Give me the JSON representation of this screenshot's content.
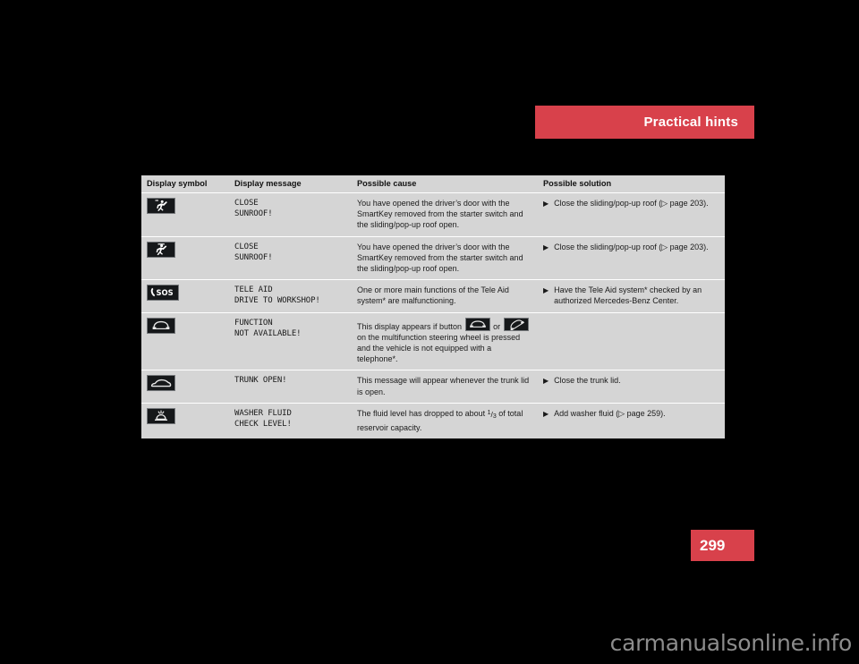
{
  "header": {
    "title": "Practical hints",
    "accent_color": "#d8414b"
  },
  "page_number": "299",
  "watermark": "carmanualsonline.info",
  "table": {
    "columns": [
      "Display symbol",
      "Display message",
      "Possible cause",
      "Possible solution"
    ],
    "rows": [
      {
        "symbol_icon": "sunroof-open-person-icon",
        "message_lines": [
          "CLOSE",
          "SUNROOF!"
        ],
        "message_alert": false,
        "cause": "You have opened the driver’s door with the SmartKey removed from the starter switch and the sliding/pop-up roof open.",
        "solution": "Close the sliding/pop-up roof (▷ page 203)."
      },
      {
        "symbol_icon": "sunroof-tilt-person-icon",
        "message_lines": [
          "CLOSE",
          "SUNROOF!"
        ],
        "message_alert": false,
        "cause": "You have opened the driver’s door with the SmartKey removed from the starter switch and the sliding/pop-up roof open.",
        "solution": "Close the sliding/pop-up roof (▷ page 203)."
      },
      {
        "symbol_icon": "sos-phone-icon",
        "message_lines": [
          "TELE AID",
          "DRIVE TO WORKSHOP!"
        ],
        "message_alert": true,
        "cause": "One or more main functions of the Tele Aid system* are malfunctioning.",
        "solution": "Have the Tele Aid system* checked by an authorized Mercedes-Benz Center."
      },
      {
        "symbol_icon": "telephone-handset-icon",
        "message_lines": [
          "FUNCTION",
          "NOT AVAILABLE!"
        ],
        "message_alert": false,
        "cause_part1": "This display appears if button",
        "cause_icon1": "telephone-handset-icon",
        "cause_part2": "or",
        "cause_icon2": "phone-hangup-icon",
        "cause_part3": "on the multifunction steering wheel is pressed and the vehicle is not equipped with a telephone*.",
        "solution": ""
      },
      {
        "symbol_icon": "trunk-open-icon",
        "message_lines": [
          "TRUNK OPEN!"
        ],
        "message_alert": true,
        "cause": "This message will appear whenever the trunk lid is open.",
        "solution": "Close the trunk lid."
      },
      {
        "symbol_icon": "washer-fluid-icon",
        "message_lines": [
          "WASHER FLUID",
          "CHECK LEVEL!"
        ],
        "message_alert": false,
        "cause_prefix": "The fluid level has dropped to about ",
        "cause_fraction_numerator": "1",
        "cause_fraction_denominator": "3",
        "cause_suffix": " of total reservoir capacity.",
        "solution": "Add washer fluid (▷ page 259)."
      }
    ],
    "bullet_glyph": "▶"
  }
}
